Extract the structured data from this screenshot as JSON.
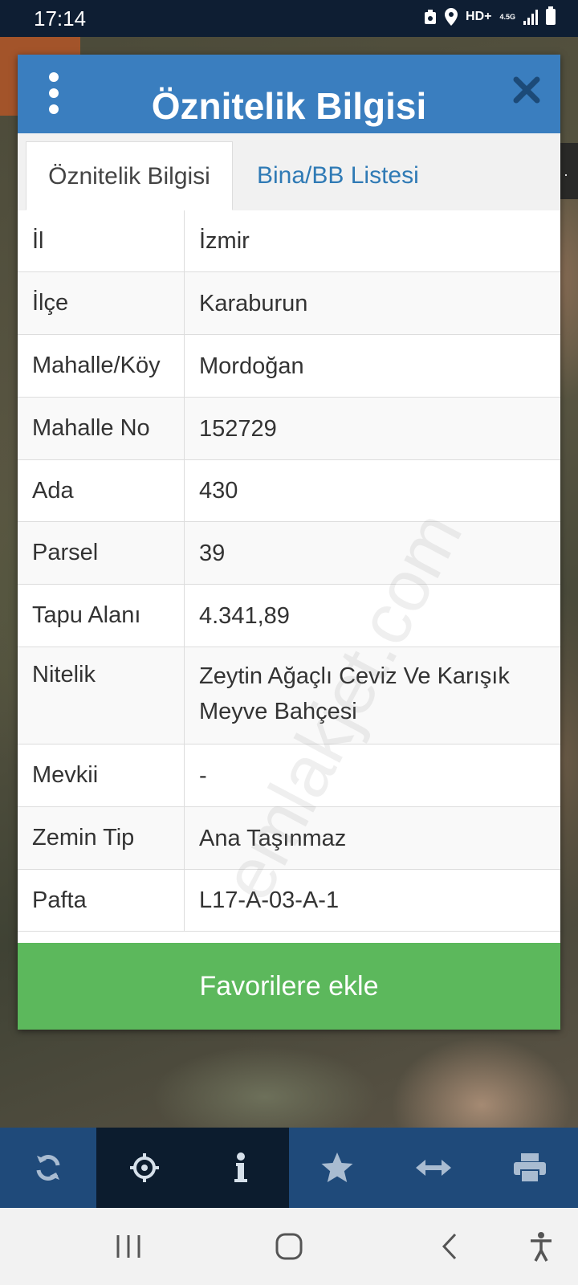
{
  "status_bar": {
    "time": "17:14",
    "network": "HD+",
    "network_type": "4.5G",
    "icons": [
      "recycle-icon",
      "location-icon",
      "signal-icon",
      "battery-icon"
    ]
  },
  "modal": {
    "title": "Öznitelik Bilgisi",
    "menu_icon": "vertical-dots-icon",
    "close_icon": "close-icon",
    "tabs": [
      {
        "label": "Öznitelik Bilgisi",
        "active": true
      },
      {
        "label": "Bina/BB Listesi",
        "active": false
      }
    ],
    "rows": [
      {
        "label": "İl",
        "value": "İzmir"
      },
      {
        "label": "İlçe",
        "value": "Karaburun"
      },
      {
        "label": "Mahalle/Köy",
        "value": "Mordoğan"
      },
      {
        "label": "Mahalle No",
        "value": "152729"
      },
      {
        "label": "Ada",
        "value": "430"
      },
      {
        "label": "Parsel",
        "value": "39"
      },
      {
        "label": "Tapu Alanı",
        "value": "4.341,89"
      },
      {
        "label": "Nitelik",
        "value": "Zeytin Ağaçlı Ceviz Ve Karışık Meyve Bahçesi"
      },
      {
        "label": "Mevkii",
        "value": "-"
      },
      {
        "label": "Zemin Tip",
        "value": "Ana Taşınmaz"
      },
      {
        "label": "Pafta",
        "value": "L17-A-03-A-1"
      }
    ],
    "favorite_button": "Favorilere ekle"
  },
  "watermark": "emlakjet.com",
  "toolbar": {
    "items": [
      {
        "icon": "refresh-icon"
      },
      {
        "icon": "crosshair-icon"
      },
      {
        "icon": "info-icon"
      },
      {
        "icon": "star-icon"
      },
      {
        "icon": "measure-arrows-icon"
      },
      {
        "icon": "print-icon"
      }
    ]
  },
  "colors": {
    "header": "#3a7ebf",
    "tab_link": "#2f7ab5",
    "favorite_button": "#5cb85c",
    "toolbar": "#1f4a7a",
    "toolbar_active": "#0c1c2e"
  }
}
